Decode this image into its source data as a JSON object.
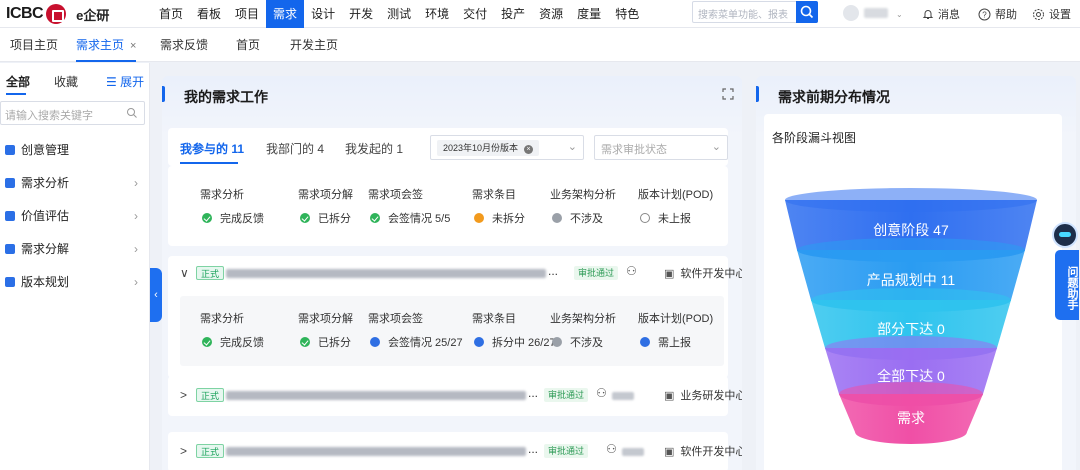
{
  "topbar": {
    "logo": "ICBC",
    "brand": "e企研",
    "nav": [
      "首页",
      "看板",
      "项目",
      "需求",
      "设计",
      "开发",
      "测试",
      "环境",
      "交付",
      "投产",
      "资源",
      "度量",
      "特色"
    ],
    "active_nav": "需求",
    "search_placeholder": "搜索菜单功能、报表",
    "messages": "消息",
    "help": "帮助",
    "settings": "设置",
    "user_name": "",
    "user_initial": ""
  },
  "tabs": [
    {
      "label": "项目主页",
      "closable": false
    },
    {
      "label": "需求主页",
      "closable": true,
      "active": true
    },
    {
      "label": "需求反馈",
      "closable": false
    },
    {
      "label": "首页",
      "closable": false
    },
    {
      "label": "开发主页",
      "closable": false
    }
  ],
  "sidebar": {
    "tab_all": "全部",
    "tab_fav": "收藏",
    "expand": "展开",
    "search_placeholder": "请输入搜索关键字",
    "items": [
      {
        "label": "创意管理",
        "arrow": false
      },
      {
        "label": "需求分析",
        "arrow": true
      },
      {
        "label": "价值评估",
        "arrow": true
      },
      {
        "label": "需求分解",
        "arrow": true
      },
      {
        "label": "版本规划",
        "arrow": true
      }
    ]
  },
  "work": {
    "title": "我的需求工作",
    "filters": [
      "我参与的 11",
      "我部门的 4",
      "我发起的 1"
    ],
    "version_chip": "2023年10月份版本",
    "status_placeholder": "需求审批状态",
    "summary": [
      {
        "h": "需求分析",
        "s": "完成反馈",
        "c": "green"
      },
      {
        "h": "需求项分解",
        "s": "已拆分",
        "c": "green"
      },
      {
        "h": "需求项会签",
        "s": "会签情况 5/5",
        "c": "green"
      },
      {
        "h": "需求条目",
        "s": "未拆分",
        "c": "orange"
      },
      {
        "h": "业务架构分析",
        "s": "不涉及",
        "c": "gray"
      },
      {
        "h": "版本计划(POD)",
        "s": "未上报",
        "c": "hollow"
      }
    ],
    "requests": [
      {
        "caret": "∨",
        "badge": "正式",
        "approved": "审批通过",
        "center": "软件开发中心",
        "expanded": true,
        "stages": [
          {
            "h": "需求分析",
            "s": "完成反馈",
            "c": "green"
          },
          {
            "h": "需求项分解",
            "s": "已拆分",
            "c": "green"
          },
          {
            "h": "需求项会签",
            "s": "会签情况 25/27",
            "c": "blue"
          },
          {
            "h": "需求条目",
            "s": "拆分中 26/27",
            "c": "blue"
          },
          {
            "h": "业务架构分析",
            "s": "不涉及",
            "c": "gray"
          },
          {
            "h": "版本计划(POD)",
            "s": "需上报",
            "c": "blue"
          }
        ]
      },
      {
        "caret": ">",
        "badge": "正式",
        "approved": "审批通过",
        "center": "业务研发中心",
        "expanded": false
      },
      {
        "caret": ">",
        "badge": "正式",
        "approved": "审批通过",
        "center": "软件开发中心",
        "expanded": false
      }
    ]
  },
  "dist": {
    "title": "需求前期分布情况",
    "subtitle": "各阶段漏斗视图",
    "stages": [
      {
        "label": "创意阶段 47",
        "color": "#2f6ff0"
      },
      {
        "label": "产品规划中 11",
        "color": "#2a9cf2"
      },
      {
        "label": "部分下达 0",
        "color": "#2fc4ee"
      },
      {
        "label": "全部下达 0",
        "color": "#9a6ef2"
      },
      {
        "label": "需求",
        "color": "#f04fa6"
      }
    ]
  },
  "assistant": {
    "label": "问题助手"
  }
}
